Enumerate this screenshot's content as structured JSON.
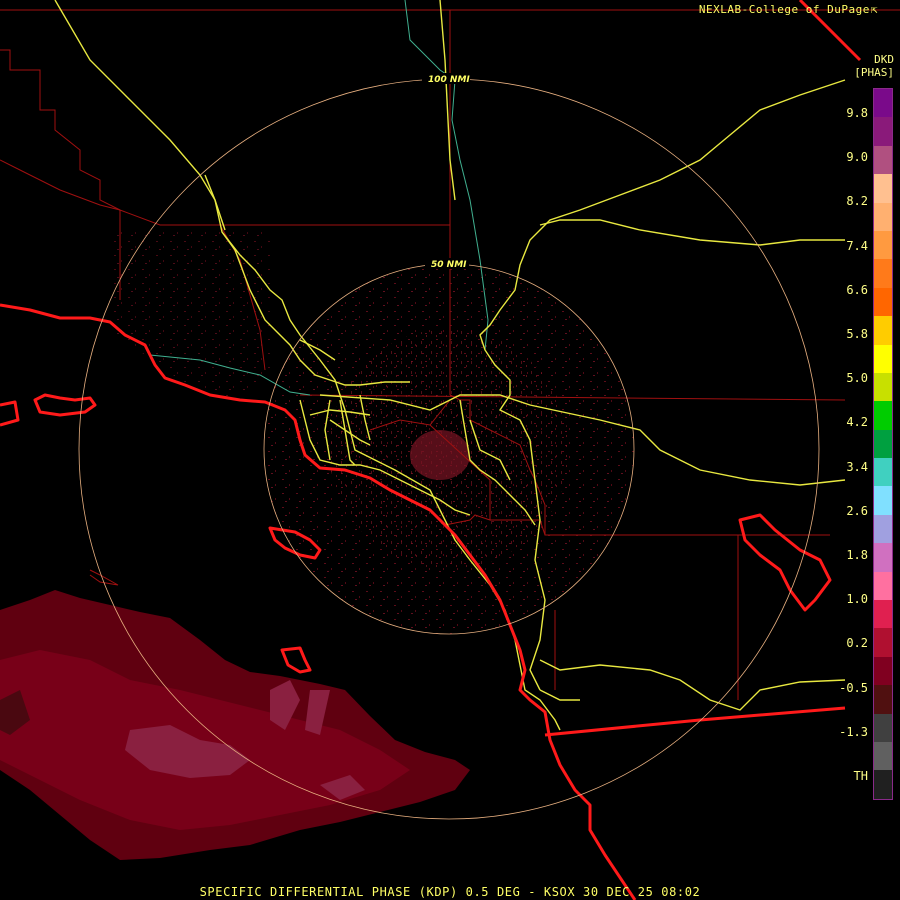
{
  "credit": {
    "text": "NEXLAB-College of DuPage",
    "mark": "⇱"
  },
  "legend": {
    "product": "DKD",
    "units": "[PHAS]",
    "ticks": [
      "9.8",
      "9.0",
      "8.2",
      "7.4",
      "6.6",
      "5.8",
      "5.0",
      "4.2",
      "3.4",
      "2.6",
      "1.8",
      "1.0",
      "0.2",
      "-0.5",
      "-1.3",
      "TH"
    ],
    "colors_top_to_bottom": [
      "#7a0a8a",
      "#8a1a7a",
      "#b05080",
      "#ffc090",
      "#ffb070",
      "#ff9a40",
      "#ff7a1a",
      "#ff6600",
      "#ffcc00",
      "#ffff00",
      "#c8e000",
      "#00cc00",
      "#00a040",
      "#40d0c0",
      "#80e0ff",
      "#a0a0e0",
      "#d070c0",
      "#ff70a0",
      "#e02050",
      "#b01030",
      "#800020",
      "#501010",
      "#404040",
      "#606060",
      "#202020"
    ]
  },
  "range_rings": [
    {
      "label": "100 NMI"
    },
    {
      "label": "50 NMI"
    }
  ],
  "footer": {
    "text": "SPECIFIC DIFFERENTIAL PHASE (KDP) 0.5 DEG - KSOX 30 DEC 25 08:02"
  }
}
